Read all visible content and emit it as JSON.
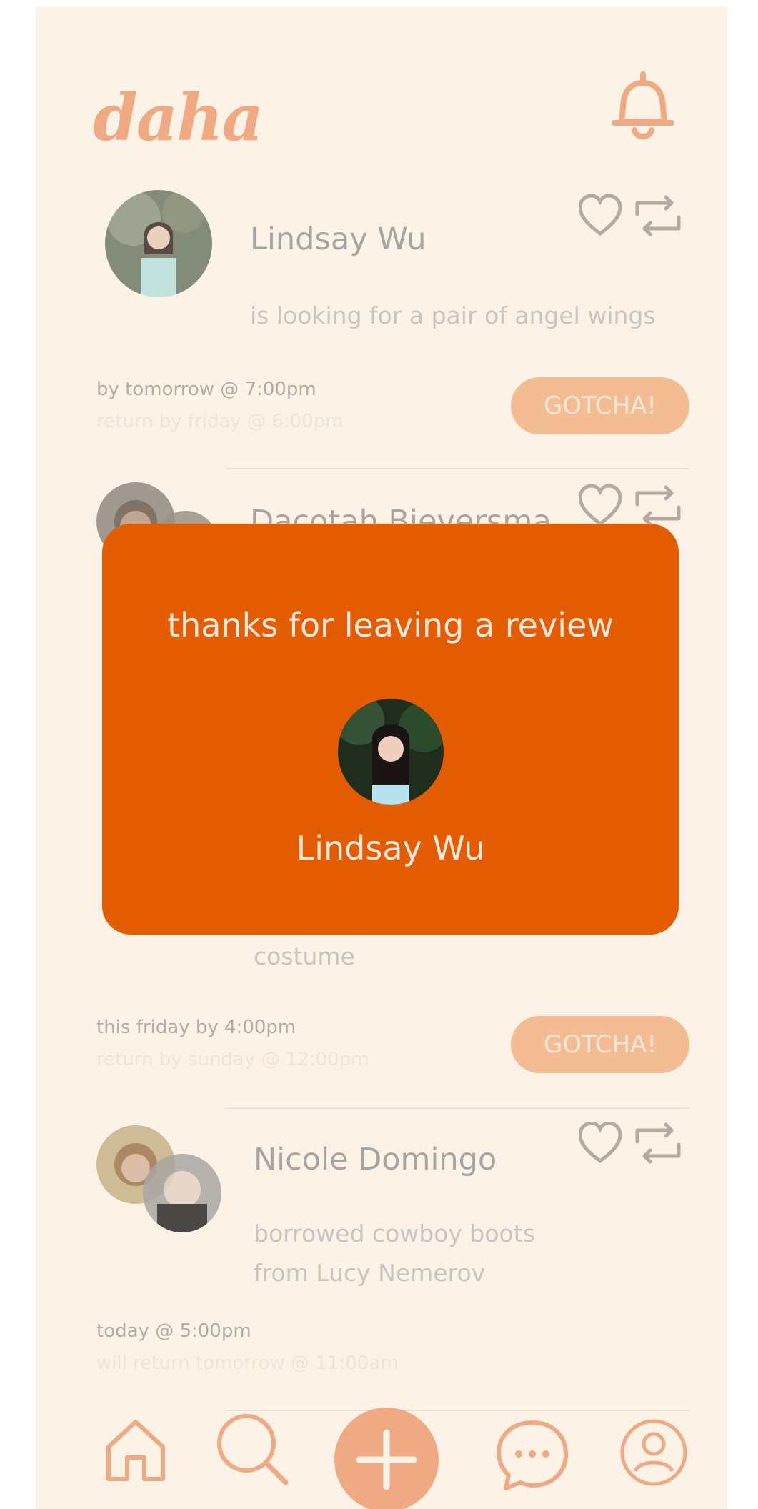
{
  "app": {
    "logo": "daha"
  },
  "feed": [
    {
      "name": "Lindsay Wu",
      "message": "is looking for a pair of angel wings",
      "when": "by tomorrow @ 7:00pm",
      "return": "return by friday @ 6:00pm",
      "action": "GOTCHA!"
    },
    {
      "name": "Dacotah Bieversma",
      "message": "costume",
      "when": "this friday by 4:00pm",
      "return": "return by sunday @ 12:00pm",
      "action": "GOTCHA!"
    },
    {
      "name": "Nicole Domingo",
      "message_line1": "borrowed cowboy boots",
      "message_line2": "from Lucy Nemerov",
      "when": "today @ 5:00pm",
      "return": "will return tomorrow @ 11:00am"
    }
  ],
  "modal": {
    "title": "thanks for leaving a review",
    "user_name": "Lindsay Wu"
  },
  "nav": {
    "items": [
      "home-icon",
      "search-icon",
      "add-icon",
      "chat-icon",
      "profile-icon"
    ]
  },
  "colors": {
    "accent": "#e35d00",
    "brand": "#efa983",
    "background": "#fcf3e6"
  }
}
